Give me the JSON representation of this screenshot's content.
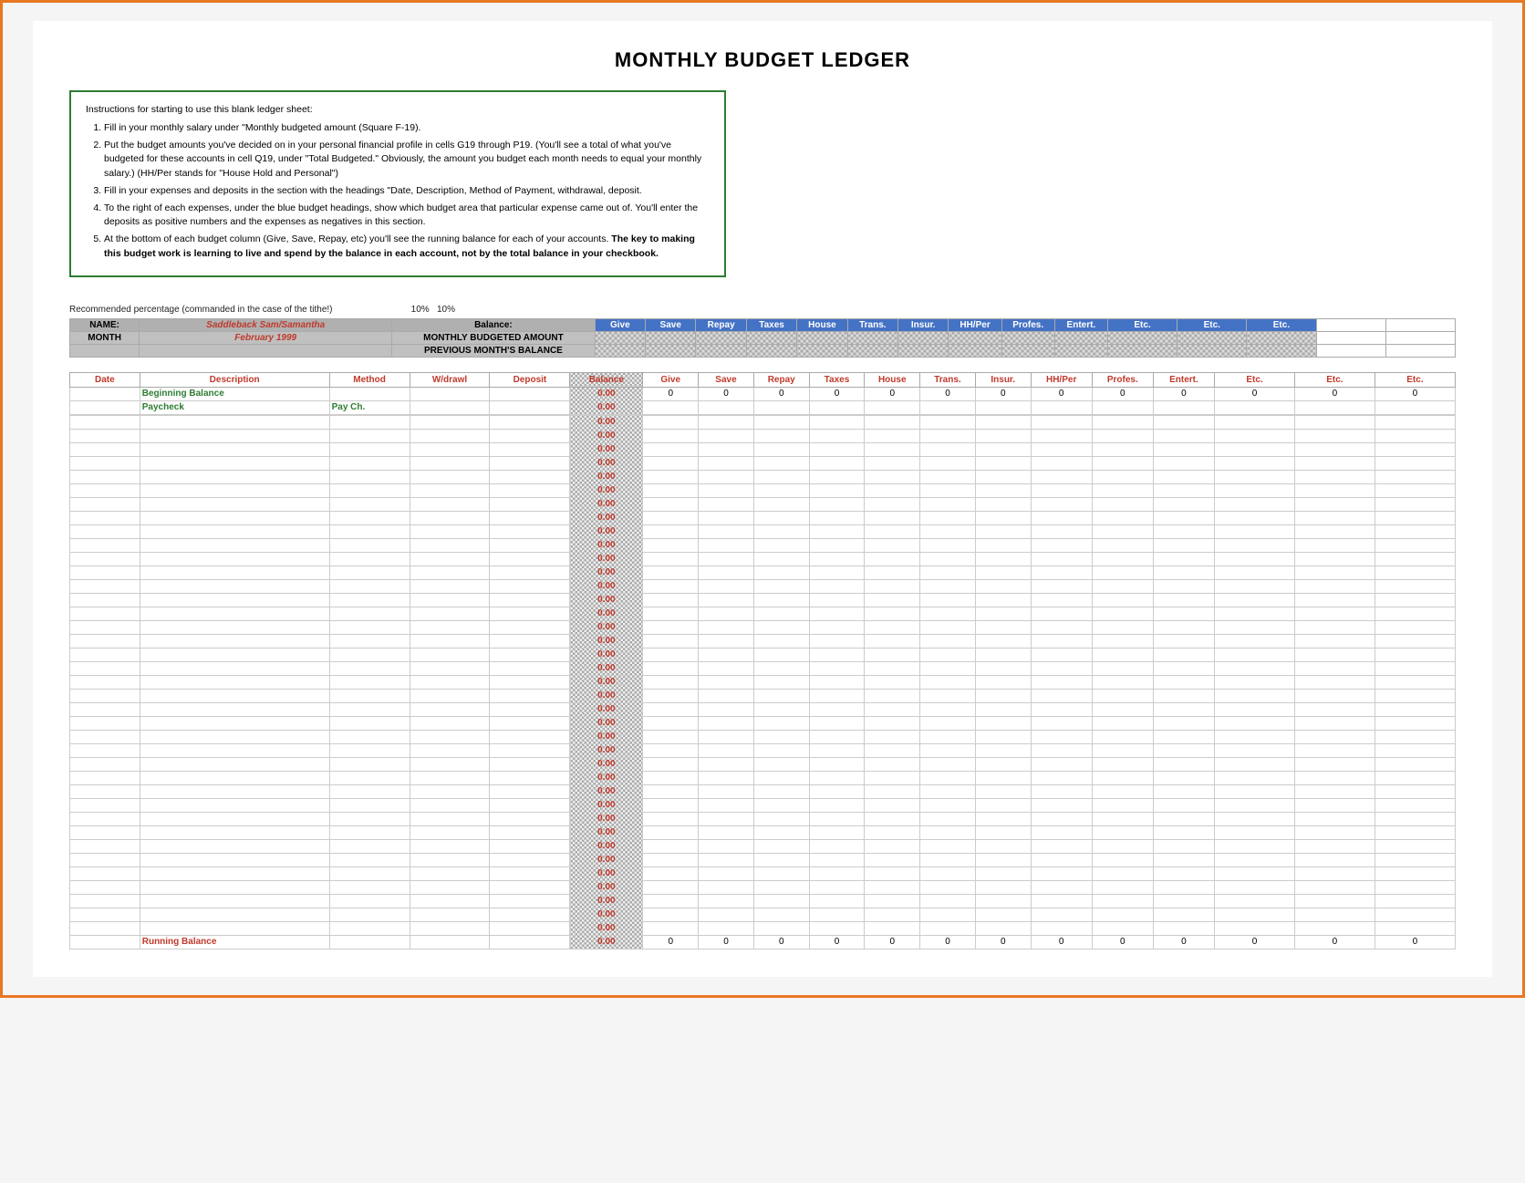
{
  "title": "MONTHLY BUDGET LEDGER",
  "instructions": {
    "heading": "Instructions for starting to use this blank ledger sheet:",
    "steps": [
      "Fill in your monthly salary under \"Monthly budgeted amount (Square F-19).",
      "Put the budget amounts you've decided on in your personal financial profile in cells G19 through P19.  (You'll see a total of what you've budgeted for these accounts in cell Q19, under \"Total Budgeted.\"  Obviously, the amount you budget each month needs to equal your monthly salary.)    (HH/Per stands for \"House Hold and Personal\")",
      "Fill in your expenses and deposits in the section with the headings \"Date, Description, Method of Payment, withdrawal, deposit.",
      "To the right of each expenses, under the blue budget headings, show which budget area that particular expense came out of.  You'll enter the deposits as positive numbers and the expenses as negatives in this section.",
      "At the bottom of each budget column (Give, Save, Repay, etc) you'll see the running balance for each of your accounts.  The key to making this budget work is learning to live and spend by the balance in each account, not by the total balance in your checkbook."
    ],
    "bold_text": "The key to making this budget work is learning to live and spend by the balance in each account, not by the total balance in your checkbook."
  },
  "rec_pct_label": "Recommended percentage (commanded in the case of the tithe!)",
  "rec_pct_val1": "10%",
  "rec_pct_val2": "10%",
  "name_label": "NAME:",
  "name_value": "Saddleback Sam/Samantha",
  "balance_label": "Balance:",
  "give_label": "Give",
  "save_label": "Save",
  "repay_label": "Repay",
  "taxes_label": "Taxes",
  "house_label": "House",
  "trans_label": "Trans.",
  "insur_label": "Insur.",
  "hhper_label": "HH/Per",
  "profes_label": "Profes.",
  "entert_label": "Entert.",
  "etc1_label": "Etc.",
  "etc2_label": "Etc.",
  "etc3_label": "Etc.",
  "month_label": "MONTH",
  "month_value": "February 1999",
  "monthly_budgeted_label": "MONTHLY BUDGETED AMOUNT",
  "prev_balance_label": "PREVIOUS MONTH'S BALANCE",
  "ledger_headers": {
    "date": "Date",
    "description": "Description",
    "method": "Method",
    "wdrawl": "W/drawl",
    "deposit": "Deposit",
    "balance": "Balance",
    "give": "Give",
    "save": "Save",
    "repay": "Repay",
    "taxes": "Taxes",
    "house": "House",
    "trans": "Trans.",
    "insur": "Insur.",
    "hhper": "HH/Per",
    "profes": "Profes.",
    "entert": "Entert.",
    "etc1": "Etc.",
    "etc2": "Etc.",
    "etc3": "Etc."
  },
  "beginning_balance": "Beginning Balance",
  "paycheck": "Paycheck",
  "paycheck_method": "Pay Ch.",
  "balance_value": "0.00",
  "running_balance": "Running Balance",
  "rows_count": 40
}
